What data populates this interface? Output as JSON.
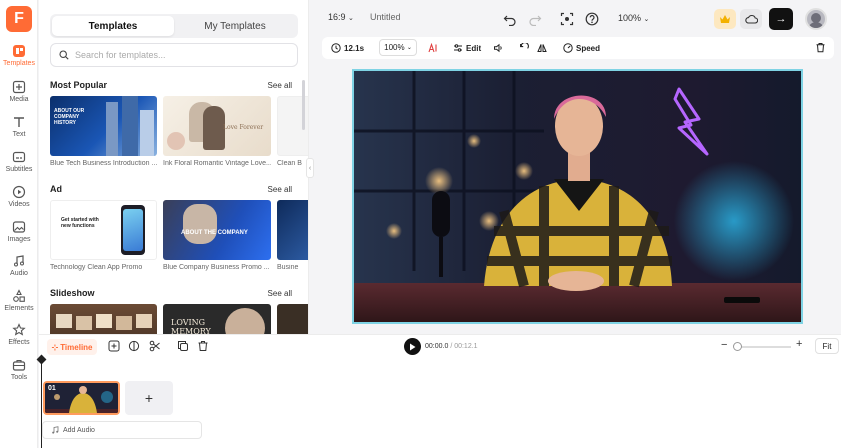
{
  "app": {
    "logo_letter": "F",
    "accent": "#ff6b35"
  },
  "rail": {
    "items": [
      {
        "label": "Templates",
        "icon": "templates-icon"
      },
      {
        "label": "Media",
        "icon": "plus-square-icon"
      },
      {
        "label": "Text",
        "icon": "text-icon"
      },
      {
        "label": "Subtitles",
        "icon": "subtitles-icon"
      },
      {
        "label": "Videos",
        "icon": "play-circle-icon"
      },
      {
        "label": "Images",
        "icon": "image-icon"
      },
      {
        "label": "Audio",
        "icon": "music-icon"
      },
      {
        "label": "Elements",
        "icon": "elements-icon"
      },
      {
        "label": "Effects",
        "icon": "effects-icon"
      },
      {
        "label": "Tools",
        "icon": "tools-icon"
      }
    ]
  },
  "panel": {
    "tabs": [
      "Templates",
      "My Templates"
    ],
    "search_placeholder": "Search for templates...",
    "sections": [
      {
        "title": "Most Popular",
        "see_all": "See all",
        "captions": [
          "Blue Tech Business Introduction ...",
          "Ink Floral Romantic Vintage Love...",
          "Clean B"
        ],
        "thumb_texts": [
          "ABOUT OUR COMPANY HISTORY",
          "Love Forever"
        ]
      },
      {
        "title": "Ad",
        "see_all": "See all",
        "captions": [
          "Technology Clean App Promo",
          "Blue Company Business Promo ...",
          "Busine"
        ],
        "thumb_texts": [
          "Get started with new functions",
          "ABOUT THE COMPANY"
        ]
      },
      {
        "title": "Slideshow",
        "see_all": "See all",
        "captions": [
          "",
          "",
          ""
        ],
        "thumb_texts": [
          "",
          "LOVING MEMORY"
        ]
      }
    ]
  },
  "topbar": {
    "ratio": "16:9",
    "title": "Untitled",
    "zoom": "100%"
  },
  "toolbar": {
    "duration": "12.1s",
    "zoom": "100%",
    "edit": "Edit",
    "speed": "Speed"
  },
  "timeline": {
    "label": "Timeline",
    "current_time": "00:00.0",
    "total_time": "/ 00:12.1",
    "fit": "Fit",
    "clip_number": "01",
    "add_audio": "Add Audio",
    "zoom_level": 0.0
  }
}
